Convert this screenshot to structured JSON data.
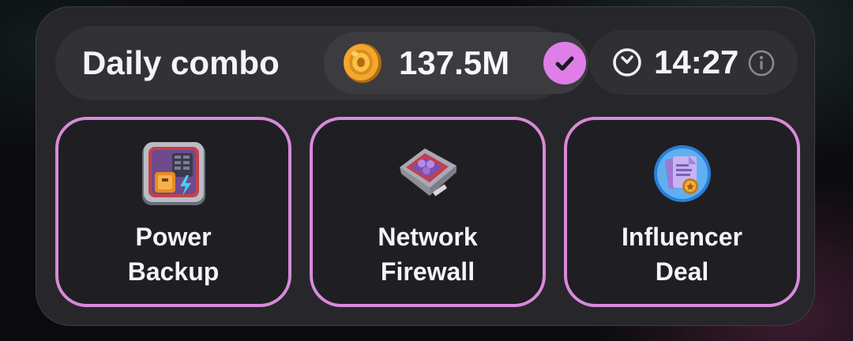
{
  "daily_combo": {
    "title": "Daily combo",
    "reward": {
      "icon": "coin-icon",
      "value": "137.5M"
    },
    "status_icon": "checkmark-icon",
    "timer": {
      "icon": "clock-icon",
      "value": "14:27",
      "info_icon": "info-icon"
    }
  },
  "cards": [
    {
      "label": "Power\nBackup",
      "icon": "power-backup-icon"
    },
    {
      "label": "Network\nFirewall",
      "icon": "network-firewall-icon"
    },
    {
      "label": "Influencer\nDeal",
      "icon": "influencer-deal-icon"
    }
  ],
  "colors": {
    "accent": "#e07ee8",
    "card_border": "#d98ad9",
    "card_bg": "#27272b",
    "tile_bg": "#1f1f23",
    "text": "#f4f4f6"
  }
}
